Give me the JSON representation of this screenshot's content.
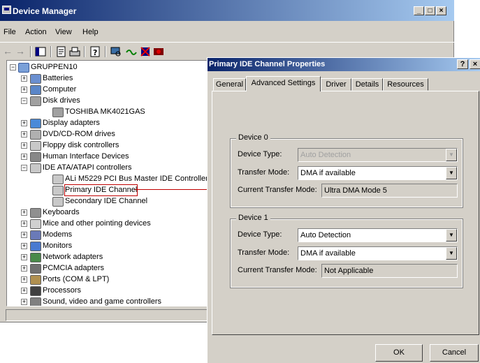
{
  "device_manager": {
    "title": "Device Manager",
    "menu": [
      "File",
      "Action",
      "View",
      "Help"
    ],
    "tree": {
      "root": "GRUPPEN10",
      "items": [
        {
          "label": "Batteries",
          "level": 1,
          "expander": "+",
          "icon": "battery-icon"
        },
        {
          "label": "Computer",
          "level": 1,
          "expander": "+",
          "icon": "computer-icon"
        },
        {
          "label": "Disk drives",
          "level": 1,
          "expander": "-",
          "icon": "disk-drive-icon"
        },
        {
          "label": "TOSHIBA MK4021GAS",
          "level": 2,
          "expander": "",
          "icon": "disk-drive-icon"
        },
        {
          "label": "Display adapters",
          "level": 1,
          "expander": "+",
          "icon": "display-icon"
        },
        {
          "label": "DVD/CD-ROM drives",
          "level": 1,
          "expander": "+",
          "icon": "cdrom-icon"
        },
        {
          "label": "Floppy disk controllers",
          "level": 1,
          "expander": "+",
          "icon": "controller-icon"
        },
        {
          "label": "Human Interface Devices",
          "level": 1,
          "expander": "+",
          "icon": "hid-icon"
        },
        {
          "label": "IDE ATA/ATAPI controllers",
          "level": 1,
          "expander": "-",
          "icon": "controller-icon"
        },
        {
          "label": "ALi M5229 PCI Bus Master IDE Controller",
          "level": 2,
          "expander": "",
          "icon": "controller-icon"
        },
        {
          "label": "Primary IDE Channel",
          "level": 2,
          "expander": "",
          "icon": "controller-icon",
          "highlighted": true
        },
        {
          "label": "Secondary IDE Channel",
          "level": 2,
          "expander": "",
          "icon": "controller-icon"
        },
        {
          "label": "Keyboards",
          "level": 1,
          "expander": "+",
          "icon": "keyboard-icon"
        },
        {
          "label": "Mice and other pointing devices",
          "level": 1,
          "expander": "+",
          "icon": "mouse-icon"
        },
        {
          "label": "Modems",
          "level": 1,
          "expander": "+",
          "icon": "modem-icon"
        },
        {
          "label": "Monitors",
          "level": 1,
          "expander": "+",
          "icon": "monitor-icon"
        },
        {
          "label": "Network adapters",
          "level": 1,
          "expander": "+",
          "icon": "network-icon"
        },
        {
          "label": "PCMCIA adapters",
          "level": 1,
          "expander": "+",
          "icon": "pcmcia-icon"
        },
        {
          "label": "Ports (COM & LPT)",
          "level": 1,
          "expander": "+",
          "icon": "port-icon"
        },
        {
          "label": "Processors",
          "level": 1,
          "expander": "+",
          "icon": "processor-icon"
        },
        {
          "label": "Sound, video and game controllers",
          "level": 1,
          "expander": "+",
          "icon": "sound-icon"
        }
      ]
    }
  },
  "dialog": {
    "title": "Primary IDE Channel Properties",
    "help": "?",
    "close": "×",
    "tabs": [
      "General",
      "Advanced Settings",
      "Driver",
      "Details",
      "Resources"
    ],
    "active_tab": "Advanced Settings",
    "device0": {
      "group": "Device 0",
      "type_label": "Device Type:",
      "type_value": "Auto Detection",
      "transfer_label": "Transfer Mode:",
      "transfer_value": "DMA if available",
      "current_label": "Current Transfer Mode:",
      "current_value": "Ultra DMA Mode 5"
    },
    "device1": {
      "group": "Device 1",
      "type_label": "Device Type:",
      "type_value": "Auto Detection",
      "transfer_label": "Transfer Mode:",
      "transfer_value": "DMA if available",
      "current_label": "Current Transfer Mode:",
      "current_value": "Not Applicable"
    },
    "ok": "OK",
    "cancel": "Cancel"
  },
  "colors": {
    "title_gradient_start": "#0a246a",
    "title_gradient_end": "#a6caf0",
    "face": "#d4d0c8",
    "highlight": "#c00000"
  }
}
